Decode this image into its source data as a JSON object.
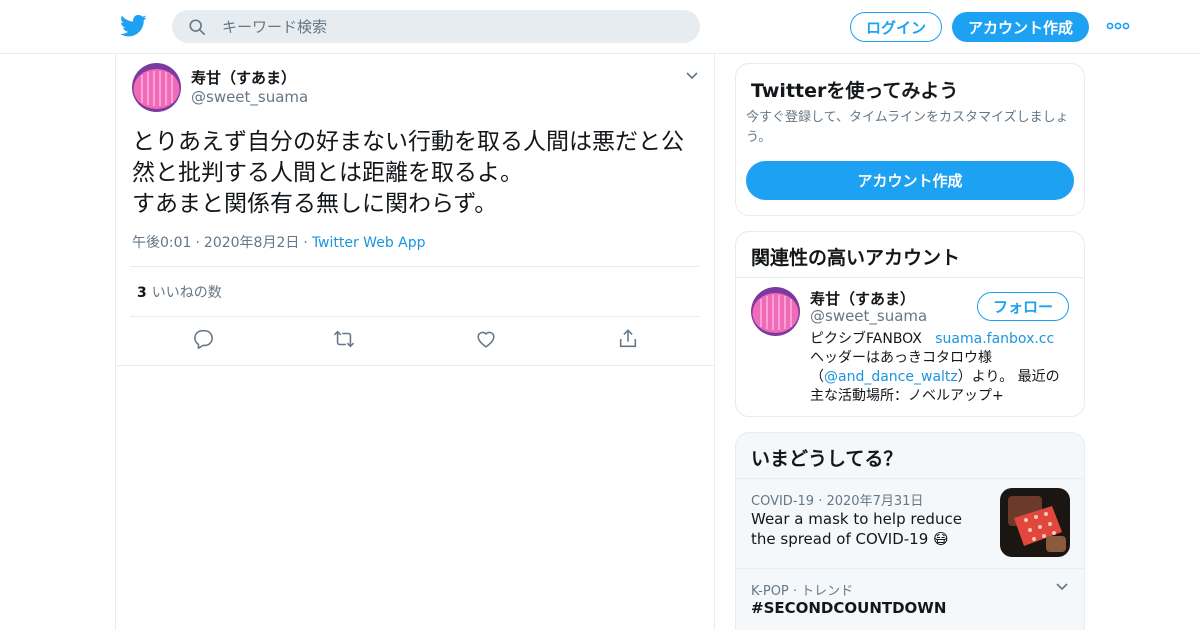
{
  "header": {
    "search_placeholder": "キーワード検索",
    "login_label": "ログイン",
    "signup_label": "アカウント作成",
    "brand_color": "#1da1f2"
  },
  "tweet": {
    "author_name": "寿甘（すあま）",
    "author_handle": "@sweet_suama",
    "text_lines": [
      "とりあえず自分の好まない行動を取る人間は悪だと公",
      "然と批判する人間とは距離を取るよ。",
      "すあまと関係有る無しに関わらず。"
    ],
    "time": "午後0:01",
    "date": "2020年8月2日",
    "separator": "·",
    "source_app": "Twitter Web App",
    "like_count": "3",
    "like_label": "いいねの数"
  },
  "sidebar": {
    "try_twitter": {
      "title": "Twitterを使ってみよう",
      "subtitle": "今すぐ登録して、タイムラインをカスタマイズしましょう。",
      "button_label": "アカウント作成"
    },
    "related": {
      "title": "関連性の高いアカウント",
      "name": "寿甘（すあま）",
      "handle": "@sweet_suama",
      "follow_label": "フォロー",
      "bio_line1_prefix": "ピクシブFANBOX",
      "bio_line1_link": "suama.fanbox.cc",
      "bio_line2": "ヘッダーはあっきコタロウ様",
      "bio_line3_open": "（",
      "bio_line3_link": "@and_dance_waltz",
      "bio_line3_rest": "）より。 最近の",
      "bio_line4": "主な活動場所：ノベルアップ+"
    },
    "trends": {
      "title": "いまどうしてる？",
      "items": [
        {
          "category": "COVID-19",
          "separator": "·",
          "date": "2020年7月31日",
          "text": "Wear a mask to help reduce the spread of COVID-19",
          "emoji": "😷"
        },
        {
          "category": "K-POP · トレンド",
          "tag": "#SECONDCOUNTDOWN"
        }
      ]
    }
  }
}
